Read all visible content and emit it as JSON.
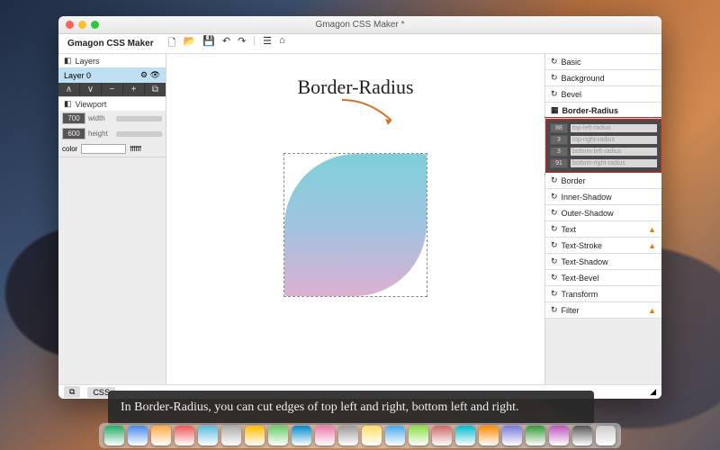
{
  "window": {
    "title": "Gmagon CSS Maker *",
    "app_name": "Gmagon CSS Maker"
  },
  "toolbar_icons": [
    "new",
    "open",
    "save",
    "undo",
    "redo",
    "rss",
    "home"
  ],
  "left": {
    "layers_label": "Layers",
    "layer0": "Layer 0",
    "viewport_label": "Viewport",
    "width_label": "width",
    "height_label": "height",
    "width_value": "700",
    "height_value": "600",
    "color_label": "color",
    "color_value": "ffffff"
  },
  "canvas": {
    "heading": "Border-Radius"
  },
  "right": {
    "items": [
      {
        "label": "Basic",
        "warn": false
      },
      {
        "label": "Background",
        "warn": false
      },
      {
        "label": "Bevel",
        "warn": false
      }
    ],
    "border_radius_label": "Border-Radius",
    "br": {
      "tl_value": "88",
      "tl_label": "top-left-radius",
      "tr_value": "3",
      "tr_label": "top-right-radius",
      "bl_value": "3",
      "bl_label": "bottom-left-radius",
      "brv": "91",
      "br_label": "bottom-right-radius"
    },
    "items2": [
      {
        "label": "Border",
        "warn": false
      },
      {
        "label": "Inner-Shadow",
        "warn": false
      },
      {
        "label": "Outer-Shadow",
        "warn": false
      },
      {
        "label": "Text",
        "warn": true
      },
      {
        "label": "Text-Stroke",
        "warn": true
      },
      {
        "label": "Text-Shadow",
        "warn": false
      },
      {
        "label": "Text-Bevel",
        "warn": false
      },
      {
        "label": "Transform",
        "warn": false
      },
      {
        "label": "Filter",
        "warn": true
      }
    ]
  },
  "footer": {
    "tab_canvas": "⧉",
    "tab_css": "CSS"
  },
  "caption": "In Border-Radius, you can cut edges of top left and right, bottom left and right.",
  "dock_count": 22
}
